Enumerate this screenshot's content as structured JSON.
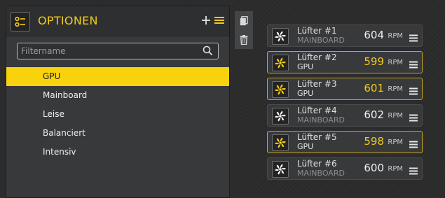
{
  "panel": {
    "title": "OPTIONEN",
    "icon": "profile-options-icon",
    "filter_placeholder": "Filtername",
    "items": [
      {
        "label": "GPU",
        "selected": true
      },
      {
        "label": "Mainboard",
        "selected": false
      },
      {
        "label": "Leise",
        "selected": false
      },
      {
        "label": "Balanciert",
        "selected": false
      },
      {
        "label": "Intensiv",
        "selected": false
      }
    ]
  },
  "tools": [
    "copy-icon",
    "trash-icon"
  ],
  "fans": [
    {
      "name": "Lüfter #1",
      "source": "MAINBOARD",
      "rpm": "604",
      "unit": "RPM",
      "active": false
    },
    {
      "name": "Lüfter #2",
      "source": "GPU",
      "rpm": "599",
      "unit": "RPM",
      "active": true
    },
    {
      "name": "Lüfter #3",
      "source": "GPU",
      "rpm": "601",
      "unit": "RPM",
      "active": true
    },
    {
      "name": "Lüfter #4",
      "source": "MAINBOARD",
      "rpm": "602",
      "unit": "RPM",
      "active": false
    },
    {
      "name": "Lüfter #5",
      "source": "GPU",
      "rpm": "598",
      "unit": "RPM",
      "active": true
    },
    {
      "name": "Lüfter #6",
      "source": "MAINBOARD",
      "rpm": "600",
      "unit": "RPM",
      "active": false
    }
  ],
  "colors": {
    "accent": "#f8d20d",
    "active_border": "#c7a71b",
    "panel": "#38393b"
  }
}
